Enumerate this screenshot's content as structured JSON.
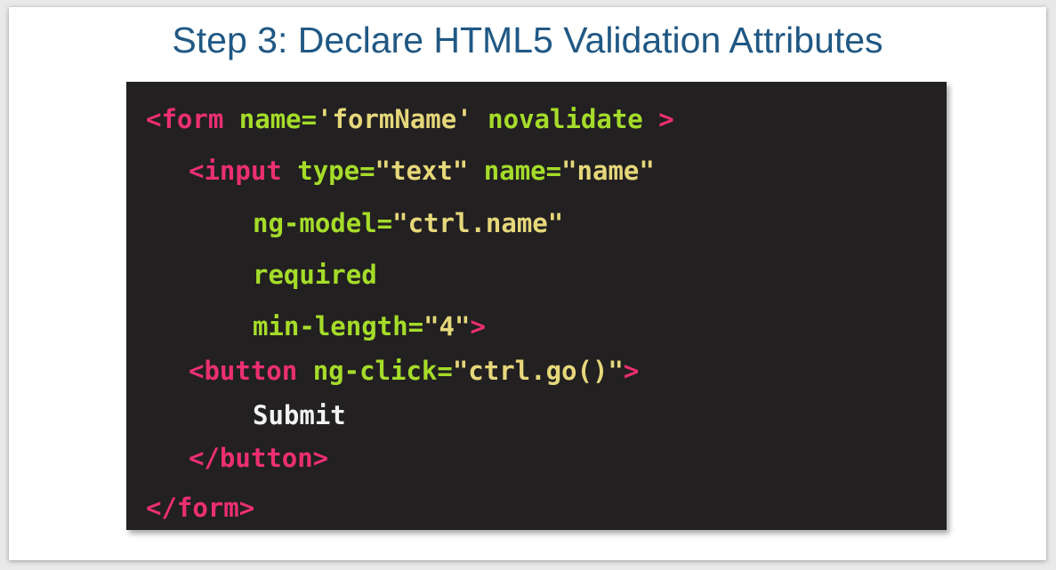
{
  "slide": {
    "title": "Step 3: Declare HTML5 Validation Attributes"
  },
  "code": {
    "lines": [
      {
        "indent": 0,
        "tokens": [
          {
            "t": "<form",
            "c": "tag"
          },
          {
            "t": " ",
            "c": "plain"
          },
          {
            "t": "name=",
            "c": "attr"
          },
          {
            "t": "'formName'",
            "c": "str"
          },
          {
            "t": " ",
            "c": "plain"
          },
          {
            "t": "novalidate",
            "c": "attr"
          },
          {
            "t": " ",
            "c": "plain"
          },
          {
            "t": ">",
            "c": "tag"
          }
        ]
      },
      {
        "indent": 1,
        "tokens": [
          {
            "t": "<input",
            "c": "tag"
          },
          {
            "t": " ",
            "c": "plain"
          },
          {
            "t": "type=",
            "c": "attr"
          },
          {
            "t": "\"text\"",
            "c": "str"
          },
          {
            "t": " ",
            "c": "plain"
          },
          {
            "t": "name=",
            "c": "attr"
          },
          {
            "t": "\"name\"",
            "c": "str"
          }
        ]
      },
      {
        "indent": 2,
        "tokens": [
          {
            "t": "ng-model=",
            "c": "attr"
          },
          {
            "t": "\"ctrl.name\"",
            "c": "str"
          }
        ]
      },
      {
        "indent": 2,
        "tokens": [
          {
            "t": "required",
            "c": "attr"
          }
        ]
      },
      {
        "indent": 2,
        "tokens": [
          {
            "t": "min-length=",
            "c": "attr"
          },
          {
            "t": "\"4\"",
            "c": "str"
          },
          {
            "t": ">",
            "c": "tag"
          }
        ]
      },
      {
        "indent": 1,
        "tokens": [
          {
            "t": "<button",
            "c": "tag"
          },
          {
            "t": " ",
            "c": "plain"
          },
          {
            "t": "ng-click=",
            "c": "attr"
          },
          {
            "t": "\"ctrl.go()\"",
            "c": "str"
          },
          {
            "t": ">",
            "c": "tag"
          }
        ]
      },
      {
        "indent": 2,
        "tokens": [
          {
            "t": "Submit",
            "c": "plain"
          }
        ]
      },
      {
        "indent": 1,
        "tokens": [
          {
            "t": "</button>",
            "c": "tag"
          }
        ]
      },
      {
        "indent": 0,
        "tokens": [
          {
            "t": "</form>",
            "c": "tag"
          }
        ]
      }
    ]
  },
  "colors": {
    "title": "#205884",
    "panel_bg": "#222021",
    "tag": "#ec2f72",
    "attribute": "#a5dc29",
    "string": "#e6d77a",
    "text": "#f2f2f2"
  }
}
